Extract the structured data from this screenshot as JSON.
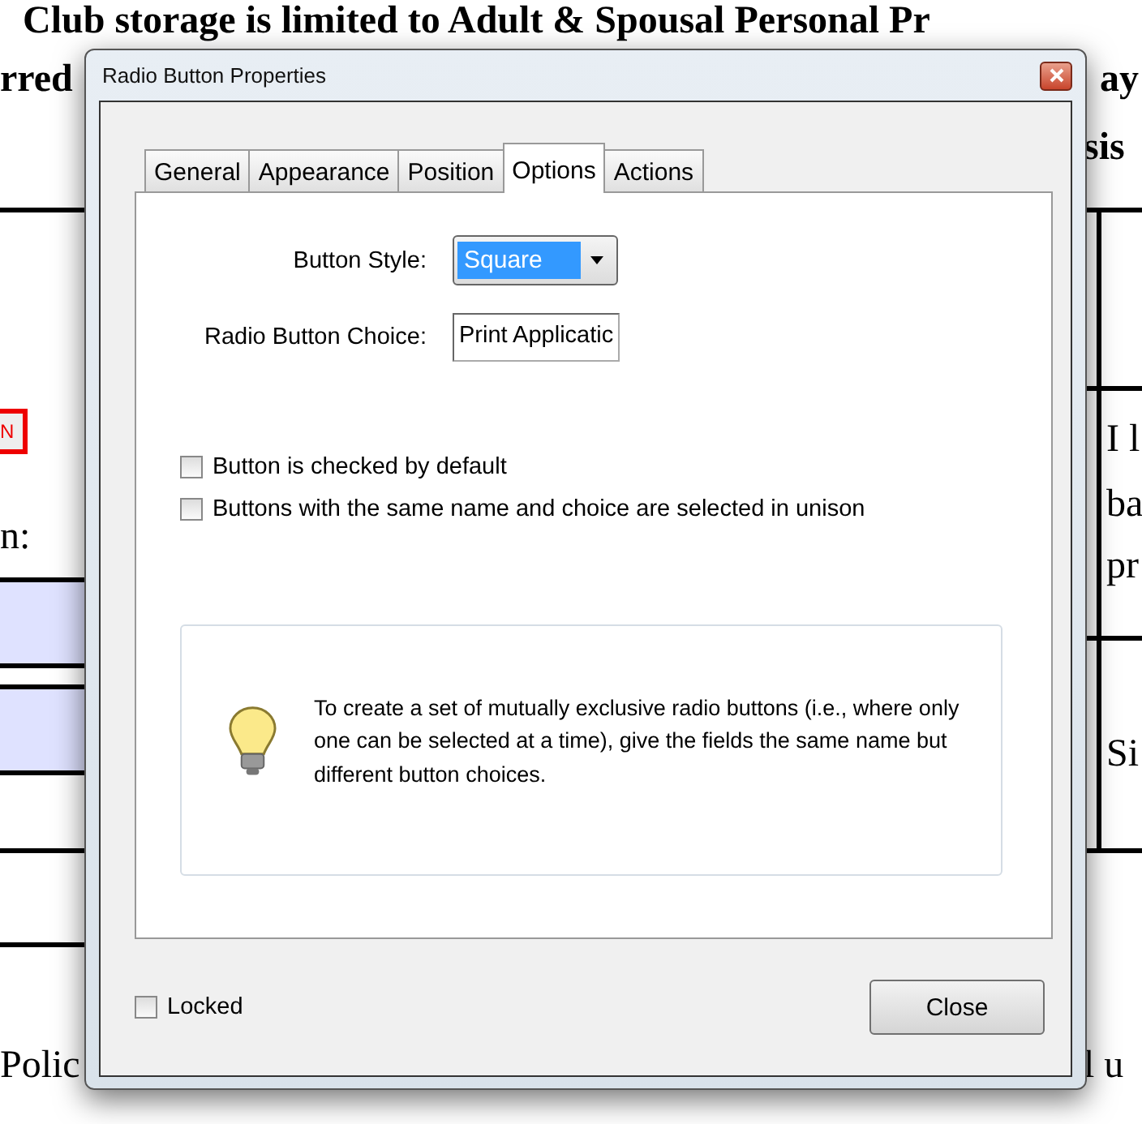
{
  "document": {
    "fragments": [
      {
        "kind": "heading",
        "text": "Club storage is limited to Adult & Spousal Personal Pr"
      },
      {
        "kind": "heading",
        "text": "rred"
      },
      {
        "kind": "heading",
        "text": "ay"
      },
      {
        "kind": "heading",
        "text": "sis"
      },
      {
        "kind": "body",
        "text": "n:"
      },
      {
        "kind": "body",
        "text": "I l"
      },
      {
        "kind": "body",
        "text": "ba"
      },
      {
        "kind": "body",
        "text": "pr"
      },
      {
        "kind": "body",
        "text": "Si"
      },
      {
        "kind": "body",
        "text": "Polic"
      },
      {
        "kind": "body",
        "text": "l u"
      }
    ],
    "form_field": {
      "text": "N"
    }
  },
  "dialog": {
    "title": "Radio Button Properties",
    "tabs": [
      {
        "label": "General",
        "selected": false
      },
      {
        "label": "Appearance",
        "selected": false
      },
      {
        "label": "Position",
        "selected": false
      },
      {
        "label": "Options",
        "selected": true
      },
      {
        "label": "Actions",
        "selected": false
      }
    ],
    "button_style": {
      "label": "Button Style:",
      "value": "Square"
    },
    "choice": {
      "label": "Radio Button Choice:",
      "value": "Print Applicatic"
    },
    "checkboxes": [
      {
        "label": "Button is checked by default",
        "checked": false
      },
      {
        "label": "Buttons with the same name and choice are selected in unison",
        "checked": false
      }
    ],
    "tip": "To create a set of mutually exclusive radio buttons (i.e., where only one can be selected at a time), give the fields the same name but different button choices.",
    "locked": {
      "label": "Locked",
      "checked": false
    },
    "close_button": "Close"
  }
}
